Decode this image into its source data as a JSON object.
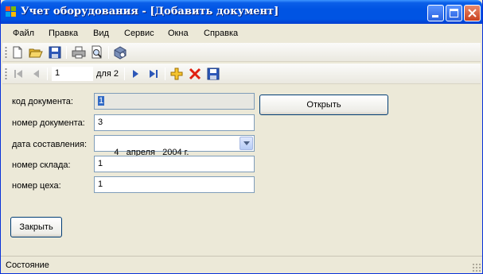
{
  "window": {
    "title": "Учет оборудования - [Добавить документ]"
  },
  "menu": {
    "items": [
      "Файл",
      "Правка",
      "Вид",
      "Сервис",
      "Окна",
      "Справка"
    ]
  },
  "toolbar": {
    "icons": [
      "new-document-icon",
      "open-folder-icon",
      "save-icon",
      "print-icon",
      "print-preview-icon",
      "help-icon"
    ]
  },
  "navigator": {
    "position_value": "1",
    "count_text": "для 2",
    "icons": [
      "move-first-icon",
      "move-previous-icon",
      "move-next-icon",
      "move-last-icon",
      "add-new-icon",
      "delete-icon",
      "save-data-icon"
    ]
  },
  "form": {
    "doc_code_label": "код документа:",
    "doc_code_value": "1",
    "doc_number_label": "номер документа:",
    "doc_number_value": "3",
    "date_label": "дата составления:",
    "date_value": "4   апреля   2004 г.",
    "warehouse_label": "номер склада:",
    "warehouse_value": "1",
    "workshop_label": "номер цеха:",
    "workshop_value": "1",
    "open_button": "Открыть",
    "close_button": "Закрыть"
  },
  "status": {
    "text": "Состояние"
  },
  "colors": {
    "titlebar": "#0054e3",
    "window_bg": "#ece9d8",
    "field_border": "#7f9db9",
    "button_border": "#003c74"
  }
}
